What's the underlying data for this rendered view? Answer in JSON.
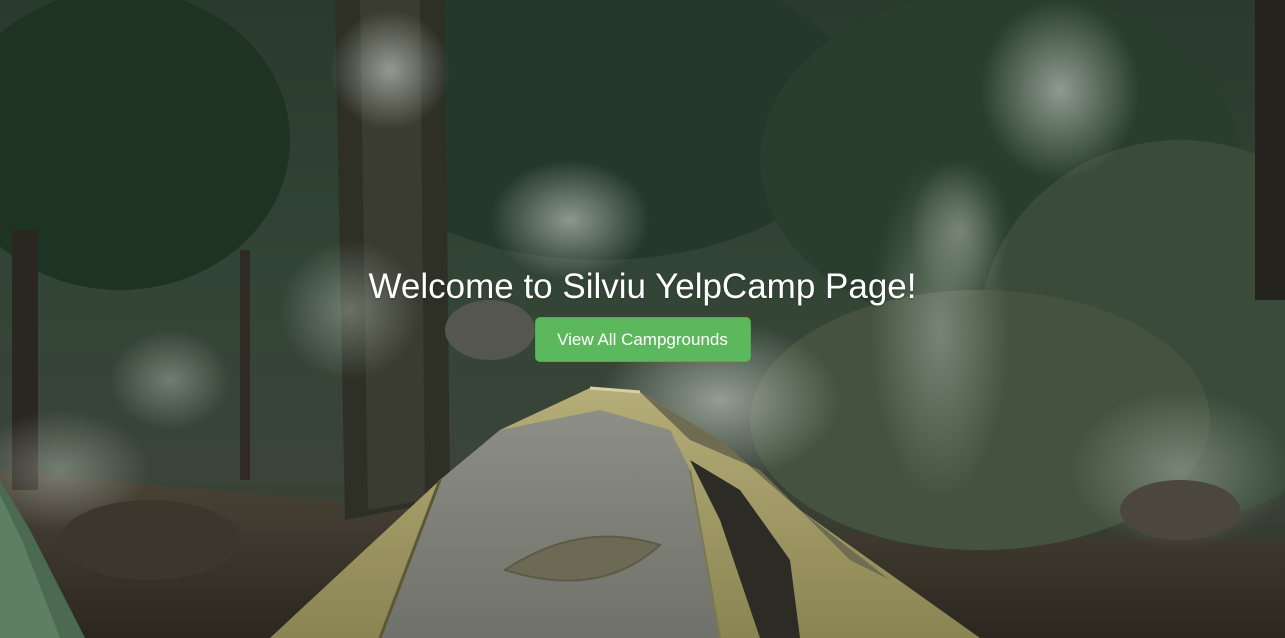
{
  "landing": {
    "title": "Welcome to Silviu YelpCamp Page!",
    "cta_label": "View All Campgrounds"
  },
  "colors": {
    "cta_background": "#5cb85c",
    "cta_border": "#4cae4c",
    "title_text": "#ffffff",
    "background_base": "#1b2a1f"
  },
  "background_image": {
    "subject": "tent-in-misty-forest"
  }
}
